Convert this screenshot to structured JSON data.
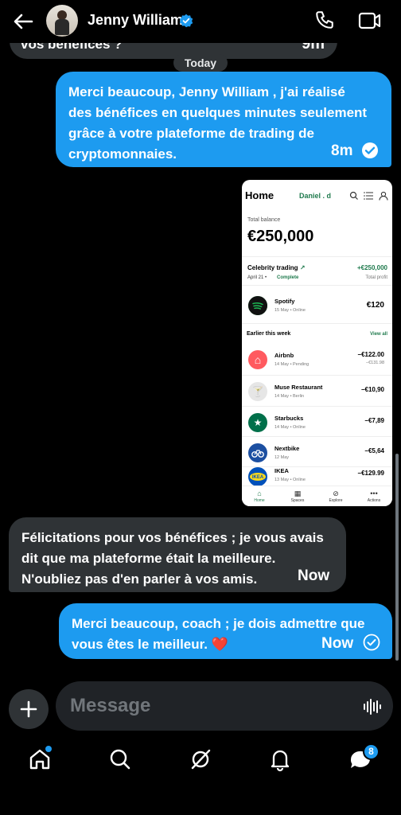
{
  "header": {
    "contact_name": "Jenny William"
  },
  "messages": [
    {
      "direction": "in",
      "text": "vos bénéfices ?",
      "time": "9m"
    },
    {
      "type": "separator",
      "label": "Today"
    },
    {
      "direction": "out",
      "lines": [
        "Merci beaucoup, Jenny William , j'ai réalisé",
        "des bénéfices en quelques minutes seulement",
        "grâce à votre plateforme de trading de",
        "cryptomonnaies."
      ],
      "time": "8m",
      "status": "read"
    },
    {
      "direction": "out",
      "type": "image"
    },
    {
      "direction": "in",
      "lines": [
        "Félicitations pour vos bénéfices ; je vous avais",
        "dit que ma plateforme était la meilleure.",
        "N'oubliez pas d'en parler à vos amis."
      ],
      "time": "Now"
    },
    {
      "direction": "out",
      "lines": [
        "Merci beaucoup, coach ; je dois admettre que",
        "vous êtes le meilleur. ❤️"
      ],
      "time": "Now",
      "status": "sent"
    }
  ],
  "screenshot": {
    "page_title": "Home",
    "user": "Daniel . d",
    "total_balance_label": "Total balance",
    "total_balance": "€250,000",
    "celebrity_trading": "Celebrity trading",
    "celebrity_amount": "+€250,000",
    "celebrity_date": "April 21",
    "celebrity_status": "Complete",
    "celebrity_sub": "Total profit",
    "featured": {
      "name": "Spotify",
      "sub": "15 May  •  Online",
      "amount": "€120"
    },
    "earlier_label": "Earlier this week",
    "view_all": "View all",
    "transactions": [
      {
        "name": "Airbnb",
        "sub": "14 May  •  Pending",
        "amount": "−€122.00",
        "amount2": "−€131.98",
        "color": "#ff5a5f",
        "glyph": "⌂"
      },
      {
        "name": "Muse Restaurant",
        "sub": "14 May  •  Berlin",
        "amount": "−€10,90",
        "color": "#e6e6e6",
        "glyph": "🍸"
      },
      {
        "name": "Starbucks",
        "sub": "14 May  •  Online",
        "amount": "−€7,89",
        "color": "#00704a",
        "glyph": "★"
      },
      {
        "name": "Nextbike",
        "sub": "12 May",
        "amount": "−€5,64",
        "color": "#1c4fa1",
        "glyph": "⚲"
      },
      {
        "name": "IKEA",
        "sub": "13 May  •  Online",
        "amount": "−€129.99",
        "color": "#0051ba",
        "glyph": "IKEA"
      }
    ],
    "nav": [
      "Home",
      "Spaces",
      "Explore",
      "Actions"
    ]
  },
  "composer": {
    "placeholder": "Message"
  },
  "bottom_nav": {
    "messages_badge": "8"
  },
  "colors": {
    "accent": "#1d9bf0",
    "incoming_bubble": "#2f3336",
    "background": "#000000"
  }
}
